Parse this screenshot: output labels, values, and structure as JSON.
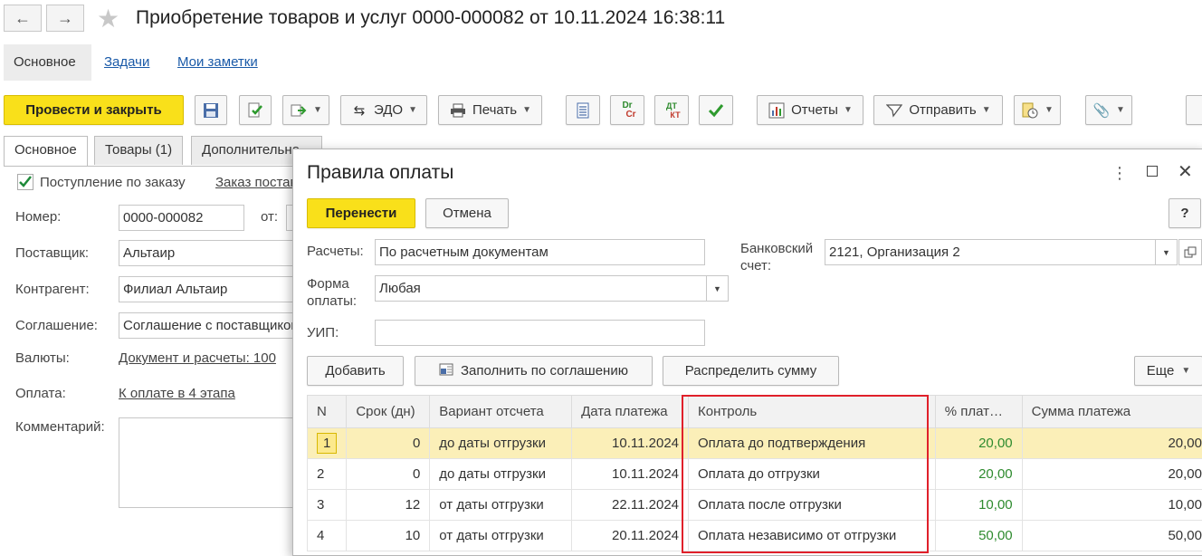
{
  "window": {
    "title": "Приобретение товаров и услуг 0000-000082 от 10.11.2024 16:38:11",
    "nav_back": "←",
    "nav_forward": "→",
    "favorite": "☆"
  },
  "sections": {
    "main": "Основное",
    "tasks": "Задачи",
    "notes": "Мои заметки"
  },
  "toolbar": {
    "post_close": "Провести и закрыть",
    "edo": "ЭДО",
    "print": "Печать",
    "reports": "Отчеты",
    "send": "Отправить",
    "dr_top": "Dr",
    "dr_bottom": "Cr",
    "dt_top": "ДТ",
    "dt_bottom": "КТ"
  },
  "tabs": [
    "Основное",
    "Товары (1)",
    "Дополнительно"
  ],
  "form": {
    "by_order_label": "Поступление по заказу",
    "order_link": "Заказ поставщику",
    "number_label": "Номер:",
    "number_value": "0000-000082",
    "from_label": "от:",
    "supplier_label": "Поставщик:",
    "supplier_value": "Альтаир",
    "counterparty_label": "Контрагент:",
    "counterparty_value": "Филиал Альтаир",
    "agreement_label": "Соглашение:",
    "agreement_value": "Соглашение с поставщиком",
    "currency_label": "Валюты:",
    "currency_link": "Документ и расчеты: 100",
    "payment_label": "Оплата:",
    "payment_link": "К оплате в 4 этапа",
    "comment_label": "Комментарий:"
  },
  "dialog": {
    "title": "Правила оплаты",
    "transfer": "Перенести",
    "cancel": "Отмена",
    "help": "?",
    "settlements_label": "Расчеты:",
    "settlements_value": "По расчетным документам",
    "payment_form_label": "Форма оплаты:",
    "payment_form_value": "Любая",
    "uip_label": "УИП:",
    "uip_value": "",
    "bank_account_label": "Банковский счет:",
    "bank_account_value": "2121, Организация 2",
    "add": "Добавить",
    "fill_by_agreement": "Заполнить по соглашению",
    "distribute_sum": "Распределить сумму",
    "more": "Еще",
    "table": {
      "columns": [
        "N",
        "Срок (дн)",
        "Вариант отсчета",
        "Дата платежа",
        "Контроль",
        "% плат…",
        "Сумма платежа"
      ],
      "rows": [
        [
          "1",
          "0",
          "до даты отгрузки",
          "10.11.2024",
          "Оплата до подтверждения",
          "20,00",
          "20,00"
        ],
        [
          "2",
          "0",
          "до даты отгрузки",
          "10.11.2024",
          "Оплата до отгрузки",
          "20,00",
          "20,00"
        ],
        [
          "3",
          "12",
          "от даты отгрузки",
          "22.11.2024",
          "Оплата после отгрузки",
          "10,00",
          "10,00"
        ],
        [
          "4",
          "10",
          "от даты отгрузки",
          "20.11.2024",
          "Оплата независимо от отгрузки",
          "50,00",
          "50,00"
        ]
      ]
    }
  },
  "colors": {
    "accent_yellow": "#f9e01a",
    "link_blue": "#1a5aa8",
    "percent_green": "#2e8b2e",
    "highlight_red": "#e0202a",
    "selected_row": "#fbefb8"
  }
}
